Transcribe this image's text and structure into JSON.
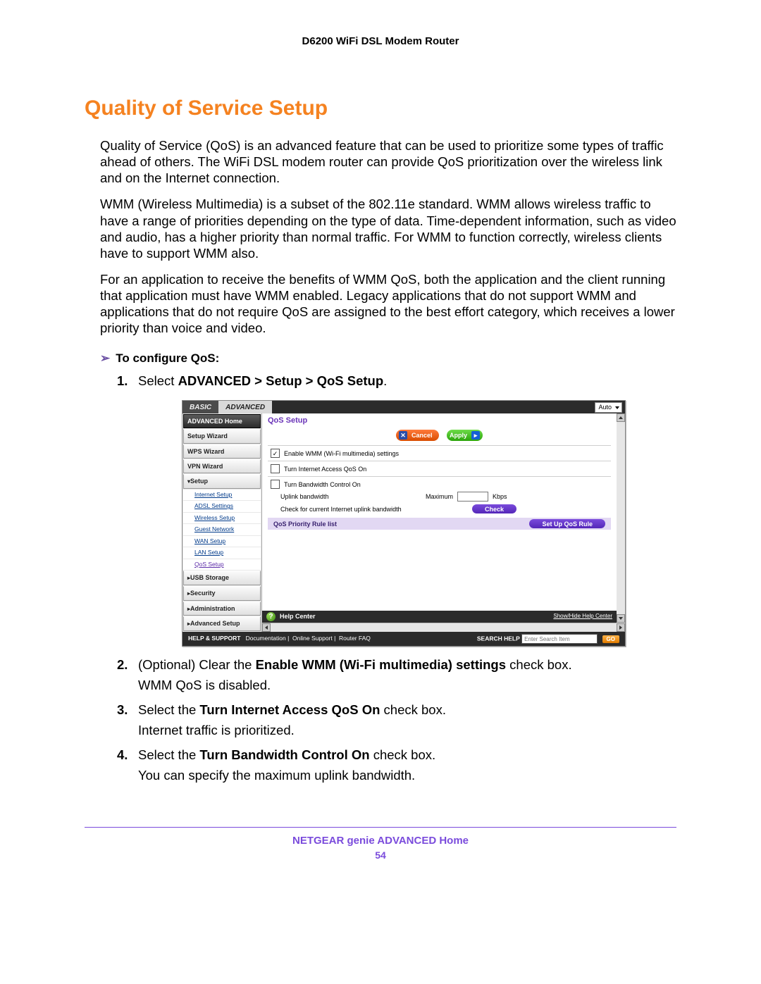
{
  "header": {
    "product": "D6200 WiFi DSL Modem Router"
  },
  "section": {
    "title": "Quality of Service Setup"
  },
  "paras": {
    "p1": "Quality of Service (QoS) is an advanced feature that can be used to prioritize some types of traffic ahead of others. The WiFi DSL modem router can provide QoS prioritization over the wireless link and on the Internet connection.",
    "p2": "WMM (Wireless Multimedia) is a subset of the 802.11e standard. WMM allows wireless traffic to have a range of priorities depending on the type of data. Time-dependent information, such as video and audio, has a higher priority than normal traffic. For WMM to function correctly, wireless clients have to support WMM also.",
    "p3": "For an application to receive the benefits of WMM QoS, both the application and the client running that application must have WMM enabled. Legacy applications that do not support WMM and applications that do not require QoS are assigned to the best effort category, which receives a lower priority than voice and video."
  },
  "proc": {
    "arrow": "➢",
    "heading": "To configure QoS:"
  },
  "steps": {
    "s1": {
      "n": "1.",
      "pre": "Select ",
      "bold": "ADVANCED > Setup > QoS Setup",
      "post": "."
    },
    "s2": {
      "n": "2.",
      "pre": "(Optional) Clear the ",
      "bold": "Enable WMM (Wi-Fi multimedia) settings",
      "post": " check box.",
      "note": "WMM QoS is disabled."
    },
    "s3": {
      "n": "3.",
      "pre": "Select the ",
      "bold": "Turn Internet Access QoS On",
      "post": " check box.",
      "note": "Internet traffic is prioritized."
    },
    "s4": {
      "n": "4.",
      "pre": "Select the ",
      "bold": "Turn Bandwidth Control On",
      "post": " check box.",
      "note": "You can specify the maximum uplink bandwidth."
    }
  },
  "router": {
    "tabs": {
      "basic": "BASIC",
      "advanced": "ADVANCED",
      "auto": "Auto"
    },
    "side": {
      "home": "ADVANCED Home",
      "setup_wiz": "Setup Wizard",
      "wps_wiz": "WPS Wizard",
      "vpn_wiz": "VPN Wizard",
      "setup": "Setup",
      "sub": {
        "internet": "Internet Setup",
        "adsl": "ADSL Settings",
        "wireless": "Wireless Setup",
        "guest": "Guest Network",
        "wan": "WAN Setup",
        "lan": "LAN Setup",
        "qos": "QoS Setup"
      },
      "usb": "USB Storage",
      "security": "Security",
      "admin": "Administration",
      "advsetup": "Advanced Setup"
    },
    "main": {
      "title": "QoS Setup",
      "cancel": "Cancel",
      "apply": "Apply",
      "enable_wmm": "Enable WMM (Wi-Fi multimedia) settings",
      "turn_internet": "Turn Internet Access QoS On",
      "turn_bw": "Turn Bandwidth Control On",
      "uplink_bw": "Uplink bandwidth",
      "maximum": "Maximum",
      "kbps": "Kbps",
      "check_uplink": "Check for current Internet uplink bandwidth",
      "check": "Check",
      "prio_hd": "QoS Priority Rule list",
      "setup_rule": "Set Up QoS Rule",
      "help_center": "Help Center",
      "show_hide": "Show/Hide Help Center"
    },
    "footer": {
      "hs": "HELP & SUPPORT",
      "doc": "Documentation",
      "online": "Online Support",
      "faq": "Router FAQ",
      "search_help": "SEARCH HELP",
      "placeholder": "Enter Search Item",
      "go": "GO"
    }
  },
  "footer": {
    "title": "NETGEAR genie ADVANCED Home",
    "page": "54"
  }
}
